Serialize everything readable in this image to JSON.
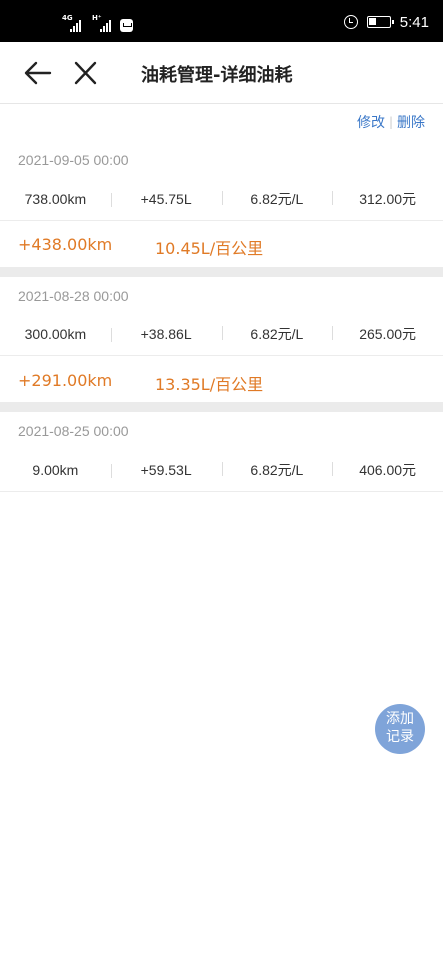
{
  "status_bar": {
    "network1": "4G",
    "network2": "H⁺",
    "time": "5:41"
  },
  "nav": {
    "title": "油耗管理-详细油耗"
  },
  "actions": {
    "edit": "修改",
    "delete": "删除"
  },
  "records": [
    {
      "date": "2021-09-05 00:00",
      "odometer": "738.00km",
      "fuel": "+45.75L",
      "price": "6.82元/L",
      "cost": "312.00元",
      "distance": "+438.00km",
      "consumption": "10.45L/百公里"
    },
    {
      "date": "2021-08-28 00:00",
      "odometer": "300.00km",
      "fuel": "+38.86L",
      "price": "6.82元/L",
      "cost": "265.00元",
      "distance": "+291.00km",
      "consumption": "13.35L/百公里"
    },
    {
      "date": "2021-08-25 00:00",
      "odometer": "9.00km",
      "fuel": "+59.53L",
      "price": "6.82元/L",
      "cost": "406.00元"
    }
  ],
  "fab": {
    "line1": "添加",
    "line2": "记录"
  },
  "colors": {
    "accent_blue": "#3b78c8",
    "highlight_orange": "#e07a26",
    "fab_bg": "#7fa4d9"
  }
}
